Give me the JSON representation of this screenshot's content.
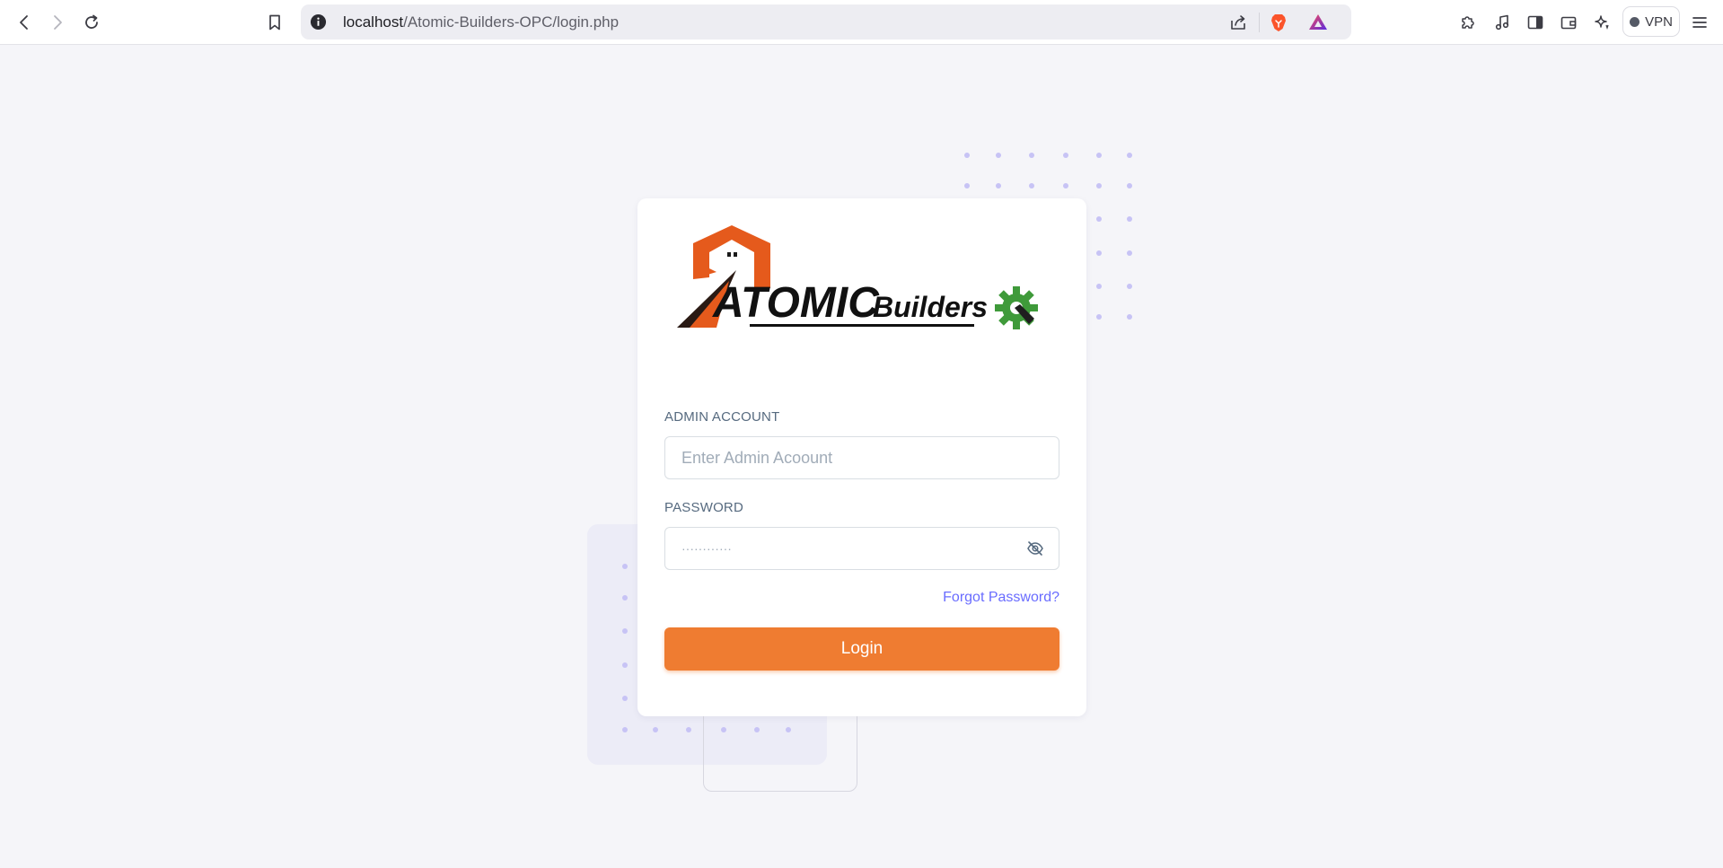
{
  "browser": {
    "url_host": "localhost",
    "url_path": "/Atomic-Builders-OPC/login.php",
    "vpn_label": "VPN",
    "icons": {
      "back": "chevron-left-icon",
      "forward": "chevron-right-icon",
      "reload": "reload-icon",
      "bookmark": "bookmark-icon",
      "site_info": "info-icon",
      "share": "share-icon",
      "brave_shields": "brave-lion-icon",
      "rewards": "triangle-icon",
      "extensions": "puzzle-icon",
      "media": "music-note-icon",
      "sidebar": "sidebar-icon",
      "wallet": "wallet-icon",
      "leo": "sparkle-icon",
      "menu": "hamburger-icon"
    }
  },
  "login": {
    "logo_text_main": "ATOMIC",
    "logo_text_sub": "Builders",
    "account_label": "ADMIN ACCOUNT",
    "account_placeholder": "Enter Admin Acoount",
    "password_label": "PASSWORD",
    "password_mask": "············",
    "forgot_link": "Forgot Password?",
    "login_button": "Login"
  },
  "colors": {
    "accent": "#ef7c31",
    "link": "#696cff",
    "background": "#f5f5f9",
    "decor_dots": "#c7c3f5"
  }
}
